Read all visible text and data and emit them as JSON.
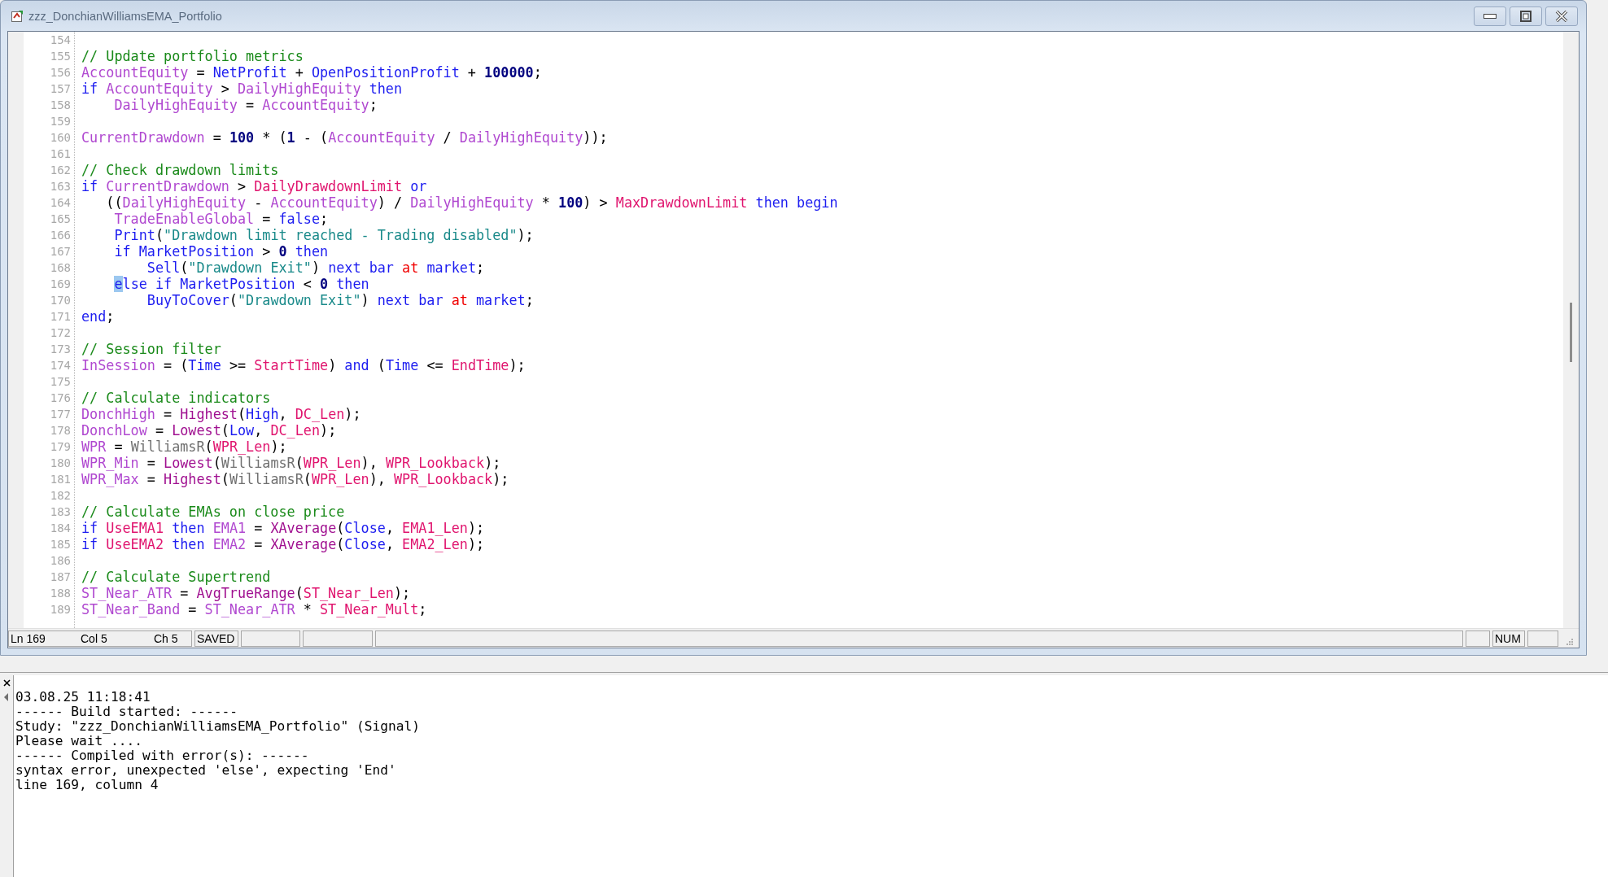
{
  "window": {
    "title": "zzz_DonchianWilliamsEMA_Portfolio"
  },
  "editor": {
    "lines": [
      {
        "number": "154"
      },
      {
        "number": "155",
        "tokens": [
          {
            "kind": "comment",
            "text": "// Update portfolio metrics"
          }
        ]
      },
      {
        "number": "156",
        "tokens": [
          {
            "kind": "variable",
            "text": "AccountEquity"
          },
          {
            "kind": "plain",
            "text": " = "
          },
          {
            "kind": "keyword",
            "text": "NetProfit"
          },
          {
            "kind": "plain",
            "text": " + "
          },
          {
            "kind": "keyword",
            "text": "OpenPositionProfit"
          },
          {
            "kind": "plain",
            "text": " + "
          },
          {
            "kind": "number",
            "text": "100000"
          },
          {
            "kind": "plain",
            "text": ";"
          }
        ]
      },
      {
        "number": "157",
        "tokens": [
          {
            "kind": "keyword",
            "text": "if "
          },
          {
            "kind": "variable",
            "text": "AccountEquity"
          },
          {
            "kind": "plain",
            "text": " > "
          },
          {
            "kind": "variable",
            "text": "DailyHighEquity"
          },
          {
            "kind": "keyword",
            "text": " then"
          }
        ]
      },
      {
        "number": "158",
        "tokens": [
          {
            "kind": "variable",
            "text": "    DailyHighEquity"
          },
          {
            "kind": "plain",
            "text": " = "
          },
          {
            "kind": "variable",
            "text": "AccountEquity"
          },
          {
            "kind": "plain",
            "text": ";"
          }
        ]
      },
      {
        "number": "159"
      },
      {
        "number": "160",
        "tokens": [
          {
            "kind": "variable",
            "text": "CurrentDrawdown"
          },
          {
            "kind": "plain",
            "text": " = "
          },
          {
            "kind": "number",
            "text": "100"
          },
          {
            "kind": "plain",
            "text": " * ("
          },
          {
            "kind": "number",
            "text": "1"
          },
          {
            "kind": "plain",
            "text": " - ("
          },
          {
            "kind": "variable",
            "text": "AccountEquity"
          },
          {
            "kind": "plain",
            "text": " / "
          },
          {
            "kind": "variable",
            "text": "DailyHighEquity"
          },
          {
            "kind": "plain",
            "text": "));"
          }
        ]
      },
      {
        "number": "161"
      },
      {
        "number": "162",
        "tokens": [
          {
            "kind": "comment",
            "text": "// Check drawdown limits"
          }
        ]
      },
      {
        "number": "163",
        "tokens": [
          {
            "kind": "keyword",
            "text": "if "
          },
          {
            "kind": "variable",
            "text": "CurrentDrawdown"
          },
          {
            "kind": "plain",
            "text": " > "
          },
          {
            "kind": "input",
            "text": "DailyDrawdownLimit"
          },
          {
            "kind": "keyword",
            "text": " or"
          }
        ]
      },
      {
        "number": "164",
        "tokens": [
          {
            "kind": "plain",
            "text": "   (("
          },
          {
            "kind": "variable",
            "text": "DailyHighEquity"
          },
          {
            "kind": "plain",
            "text": " - "
          },
          {
            "kind": "variable",
            "text": "AccountEquity"
          },
          {
            "kind": "plain",
            "text": ") / "
          },
          {
            "kind": "variable",
            "text": "DailyHighEquity"
          },
          {
            "kind": "plain",
            "text": " * "
          },
          {
            "kind": "number",
            "text": "100"
          },
          {
            "kind": "plain",
            "text": ") > "
          },
          {
            "kind": "input",
            "text": "MaxDrawdownLimit"
          },
          {
            "kind": "keyword",
            "text": " then begin"
          }
        ]
      },
      {
        "number": "165",
        "tokens": [
          {
            "kind": "variable",
            "text": "    TradeEnableGlobal"
          },
          {
            "kind": "plain",
            "text": " = "
          },
          {
            "kind": "keyword",
            "text": "false"
          },
          {
            "kind": "plain",
            "text": ";"
          }
        ]
      },
      {
        "number": "166",
        "tokens": [
          {
            "kind": "keyword",
            "text": "    Print"
          },
          {
            "kind": "plain",
            "text": "("
          },
          {
            "kind": "string",
            "text": "\"Drawdown limit reached - Trading disabled\""
          },
          {
            "kind": "plain",
            "text": ");"
          }
        ]
      },
      {
        "number": "167",
        "tokens": [
          {
            "kind": "keyword",
            "text": "    if "
          },
          {
            "kind": "keyword",
            "text": "MarketPosition"
          },
          {
            "kind": "plain",
            "text": " > "
          },
          {
            "kind": "number",
            "text": "0"
          },
          {
            "kind": "keyword",
            "text": " then"
          }
        ]
      },
      {
        "number": "168",
        "tokens": [
          {
            "kind": "keyword",
            "text": "        Sell"
          },
          {
            "kind": "plain",
            "text": "("
          },
          {
            "kind": "string",
            "text": "\"Drawdown Exit\""
          },
          {
            "kind": "plain",
            "text": ") "
          },
          {
            "kind": "keyword",
            "text": "next bar "
          },
          {
            "kind": "accent",
            "text": "at"
          },
          {
            "kind": "keyword",
            "text": " market"
          },
          {
            "kind": "plain",
            "text": ";"
          }
        ]
      },
      {
        "number": "169",
        "tokens": [
          {
            "kind": "selection",
            "text": "    e"
          },
          {
            "kind": "keyword",
            "text": "lse if "
          },
          {
            "kind": "keyword",
            "text": "MarketPosition"
          },
          {
            "kind": "plain",
            "text": " < "
          },
          {
            "kind": "number",
            "text": "0"
          },
          {
            "kind": "keyword",
            "text": " then"
          }
        ]
      },
      {
        "number": "170",
        "tokens": [
          {
            "kind": "keyword",
            "text": "        BuyToCover"
          },
          {
            "kind": "plain",
            "text": "("
          },
          {
            "kind": "string",
            "text": "\"Drawdown Exit\""
          },
          {
            "kind": "plain",
            "text": ") "
          },
          {
            "kind": "keyword",
            "text": "next bar "
          },
          {
            "kind": "accent",
            "text": "at"
          },
          {
            "kind": "keyword",
            "text": " market"
          },
          {
            "kind": "plain",
            "text": ";"
          }
        ]
      },
      {
        "number": "171",
        "tokens": [
          {
            "kind": "keyword",
            "text": "end"
          },
          {
            "kind": "plain",
            "text": ";"
          }
        ]
      },
      {
        "number": "172"
      },
      {
        "number": "173",
        "tokens": [
          {
            "kind": "comment",
            "text": "// Session filter"
          }
        ]
      },
      {
        "number": "174",
        "tokens": [
          {
            "kind": "variable",
            "text": "InSession"
          },
          {
            "kind": "plain",
            "text": " = ("
          },
          {
            "kind": "keyword",
            "text": "Time"
          },
          {
            "kind": "plain",
            "text": " >= "
          },
          {
            "kind": "input",
            "text": "StartTime"
          },
          {
            "kind": "plain",
            "text": ") "
          },
          {
            "kind": "keyword",
            "text": "and"
          },
          {
            "kind": "plain",
            "text": " ("
          },
          {
            "kind": "keyword",
            "text": "Time"
          },
          {
            "kind": "plain",
            "text": " <= "
          },
          {
            "kind": "input",
            "text": "EndTime"
          },
          {
            "kind": "plain",
            "text": ");"
          }
        ]
      },
      {
        "number": "175"
      },
      {
        "number": "176",
        "tokens": [
          {
            "kind": "comment",
            "text": "// Calculate indicators"
          }
        ]
      },
      {
        "number": "177",
        "tokens": [
          {
            "kind": "variable",
            "text": "DonchHigh"
          },
          {
            "kind": "plain",
            "text": " = "
          },
          {
            "kind": "function",
            "text": "Highest"
          },
          {
            "kind": "plain",
            "text": "("
          },
          {
            "kind": "keyword",
            "text": "High"
          },
          {
            "kind": "plain",
            "text": ", "
          },
          {
            "kind": "input",
            "text": "DC_Len"
          },
          {
            "kind": "plain",
            "text": ");"
          }
        ]
      },
      {
        "number": "178",
        "tokens": [
          {
            "kind": "variable",
            "text": "DonchLow"
          },
          {
            "kind": "plain",
            "text": " = "
          },
          {
            "kind": "function",
            "text": "Lowest"
          },
          {
            "kind": "plain",
            "text": "("
          },
          {
            "kind": "keyword",
            "text": "Low"
          },
          {
            "kind": "plain",
            "text": ", "
          },
          {
            "kind": "input",
            "text": "DC_Len"
          },
          {
            "kind": "plain",
            "text": ");"
          }
        ]
      },
      {
        "number": "179",
        "tokens": [
          {
            "kind": "variable",
            "text": "WPR"
          },
          {
            "kind": "plain",
            "text": " = "
          },
          {
            "kind": "userfunc",
            "text": "WilliamsR"
          },
          {
            "kind": "plain",
            "text": "("
          },
          {
            "kind": "input",
            "text": "WPR_Len"
          },
          {
            "kind": "plain",
            "text": ");"
          }
        ]
      },
      {
        "number": "180",
        "tokens": [
          {
            "kind": "variable",
            "text": "WPR_Min"
          },
          {
            "kind": "plain",
            "text": " = "
          },
          {
            "kind": "function",
            "text": "Lowest"
          },
          {
            "kind": "plain",
            "text": "("
          },
          {
            "kind": "userfunc",
            "text": "WilliamsR"
          },
          {
            "kind": "plain",
            "text": "("
          },
          {
            "kind": "input",
            "text": "WPR_Len"
          },
          {
            "kind": "plain",
            "text": "), "
          },
          {
            "kind": "input",
            "text": "WPR_Lookback"
          },
          {
            "kind": "plain",
            "text": ");"
          }
        ]
      },
      {
        "number": "181",
        "tokens": [
          {
            "kind": "variable",
            "text": "WPR_Max"
          },
          {
            "kind": "plain",
            "text": " = "
          },
          {
            "kind": "function",
            "text": "Highest"
          },
          {
            "kind": "plain",
            "text": "("
          },
          {
            "kind": "userfunc",
            "text": "WilliamsR"
          },
          {
            "kind": "plain",
            "text": "("
          },
          {
            "kind": "input",
            "text": "WPR_Len"
          },
          {
            "kind": "plain",
            "text": "), "
          },
          {
            "kind": "input",
            "text": "WPR_Lookback"
          },
          {
            "kind": "plain",
            "text": ");"
          }
        ]
      },
      {
        "number": "182"
      },
      {
        "number": "183",
        "tokens": [
          {
            "kind": "comment",
            "text": "// Calculate EMAs on close price"
          }
        ]
      },
      {
        "number": "184",
        "tokens": [
          {
            "kind": "keyword",
            "text": "if "
          },
          {
            "kind": "input",
            "text": "UseEMA1"
          },
          {
            "kind": "keyword",
            "text": " then "
          },
          {
            "kind": "variable",
            "text": "EMA1"
          },
          {
            "kind": "plain",
            "text": " = "
          },
          {
            "kind": "function",
            "text": "XAverage"
          },
          {
            "kind": "plain",
            "text": "("
          },
          {
            "kind": "keyword",
            "text": "Close"
          },
          {
            "kind": "plain",
            "text": ", "
          },
          {
            "kind": "input",
            "text": "EMA1_Len"
          },
          {
            "kind": "plain",
            "text": ");"
          }
        ]
      },
      {
        "number": "185",
        "tokens": [
          {
            "kind": "keyword",
            "text": "if "
          },
          {
            "kind": "input",
            "text": "UseEMA2"
          },
          {
            "kind": "keyword",
            "text": " then "
          },
          {
            "kind": "variable",
            "text": "EMA2"
          },
          {
            "kind": "plain",
            "text": " = "
          },
          {
            "kind": "function",
            "text": "XAverage"
          },
          {
            "kind": "plain",
            "text": "("
          },
          {
            "kind": "keyword",
            "text": "Close"
          },
          {
            "kind": "plain",
            "text": ", "
          },
          {
            "kind": "input",
            "text": "EMA2_Len"
          },
          {
            "kind": "plain",
            "text": ");"
          }
        ]
      },
      {
        "number": "186"
      },
      {
        "number": "187",
        "tokens": [
          {
            "kind": "comment",
            "text": "// Calculate Supertrend"
          }
        ]
      },
      {
        "number": "188",
        "tokens": [
          {
            "kind": "variable",
            "text": "ST_Near_ATR"
          },
          {
            "kind": "plain",
            "text": " = "
          },
          {
            "kind": "function",
            "text": "AvgTrueRange"
          },
          {
            "kind": "plain",
            "text": "("
          },
          {
            "kind": "input",
            "text": "ST_Near_Len"
          },
          {
            "kind": "plain",
            "text": ");"
          }
        ]
      },
      {
        "number": "189",
        "tokens": [
          {
            "kind": "variable",
            "text": "ST_Near_Band"
          },
          {
            "kind": "plain",
            "text": " = "
          },
          {
            "kind": "variable",
            "text": "ST_Near_ATR"
          },
          {
            "kind": "plain",
            "text": " * "
          },
          {
            "kind": "input",
            "text": "ST_Near_Mult"
          },
          {
            "kind": "plain",
            "text": ";"
          }
        ]
      }
    ]
  },
  "status_bar": {
    "line": "Ln 169",
    "column": "Col 5",
    "char": "Ch 5",
    "state": "SAVED",
    "num_lock": "NUM"
  },
  "output": {
    "lines": [
      "03.08.25 11:18:41",
      "------ Build started: ------",
      "Study: \"zzz_DonchianWilliamsEMA_Portfolio\" (Signal)",
      "Please wait ....",
      "------ Compiled with error(s): ------",
      "syntax error, unexpected 'else', expecting 'End'",
      "line 169, column 4"
    ]
  }
}
